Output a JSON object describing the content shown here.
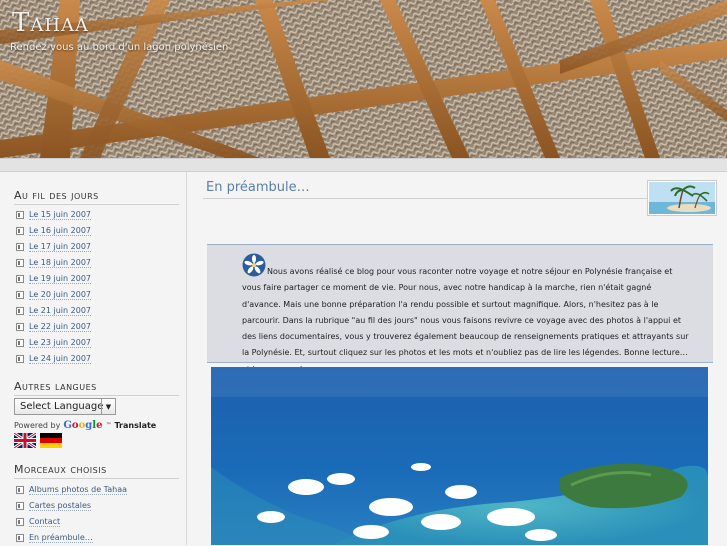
{
  "header": {
    "title": "Tahaa",
    "tagline": "Rendez-vous au bord d'un lagon polynésien"
  },
  "sidebar": {
    "days_heading": "Au fil des jours",
    "days": [
      "Le 15 juin 2007",
      "Le 16 juin 2007",
      "Le 17 juin 2007",
      "Le 18 juin 2007",
      "Le 19 juin 2007",
      "Le 20 juin 2007",
      "Le 21 juin 2007",
      "Le 22 juin 2007",
      "Le 23 juin 2007",
      "Le 24 juin 2007"
    ],
    "languages_heading": "Autres langues",
    "select_language": "Select Language",
    "powered_by": "Powered by",
    "google": "Google",
    "tm": "™",
    "translate": "Translate",
    "picks_heading": "Morceaux choisis",
    "picks": [
      "Albums photos de Tahaa",
      "Cartes postales",
      "Contact",
      "En préambule…"
    ]
  },
  "main": {
    "post_title": "En préambule…",
    "intro": "Nous avons réalisé ce blog pour vous raconter notre voyage et notre séjour en Polynésie française et vous faire partager ce moment de vie. Pour nous, avec notre handicap à la marche, rien n'était gagné d'avance. Mais une bonne préparation l'a rendu possible et surtout magnifique. Alors, n'hesitez pas à le parcourir. Dans la rubrique \"au fil des jours\" nous vous faisons revivre ce voyage avec des photos à l'appui et des liens documentaires, vous y trouverez également beaucoup de renseignements pratiques et attrayants sur la Polynésie. Et, surtout cliquez sur les photos et les mots et n'oubliez pas de lire les légendes. Bonne lecture… et bon voyage!"
  },
  "colors": {
    "link": "#3a5b86",
    "title": "#5a7fa8",
    "intro_bg": "#dcdde3"
  }
}
